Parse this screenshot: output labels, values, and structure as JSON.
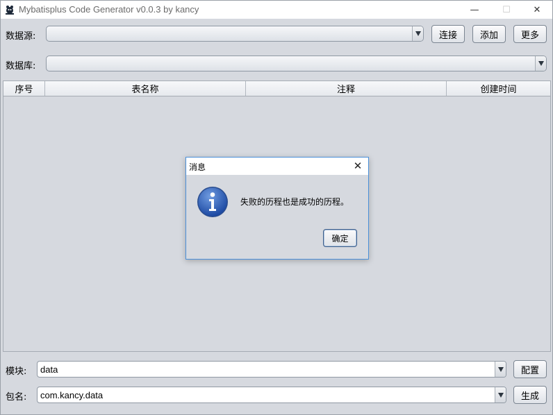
{
  "window": {
    "title": "Mybatisplus Code Generator v0.0.3 by kancy",
    "minimize": "—",
    "maximize": "☐",
    "close": "✕"
  },
  "datasource": {
    "label": "数据源:",
    "value": "",
    "connect_label": "连接",
    "add_label": "添加",
    "more_label": "更多"
  },
  "database": {
    "label": "数据库:",
    "value": ""
  },
  "table": {
    "columns": [
      "序号",
      "表名称",
      "注释",
      "创建时间"
    ],
    "rows": []
  },
  "module": {
    "label": "模块:",
    "value": "data",
    "config_label": "配置"
  },
  "package": {
    "label": "包名:",
    "value": "com.kancy.data",
    "generate_label": "生成"
  },
  "dialog": {
    "title": "消息",
    "close": "✕",
    "message": "失败的历程也是成功的历程。",
    "ok_label": "确定",
    "icon": "info-icon"
  },
  "colors": {
    "window_bg": "#d6d9df",
    "dialog_border": "#4a90d9",
    "info_icon_blue": "#2a5fb8"
  }
}
